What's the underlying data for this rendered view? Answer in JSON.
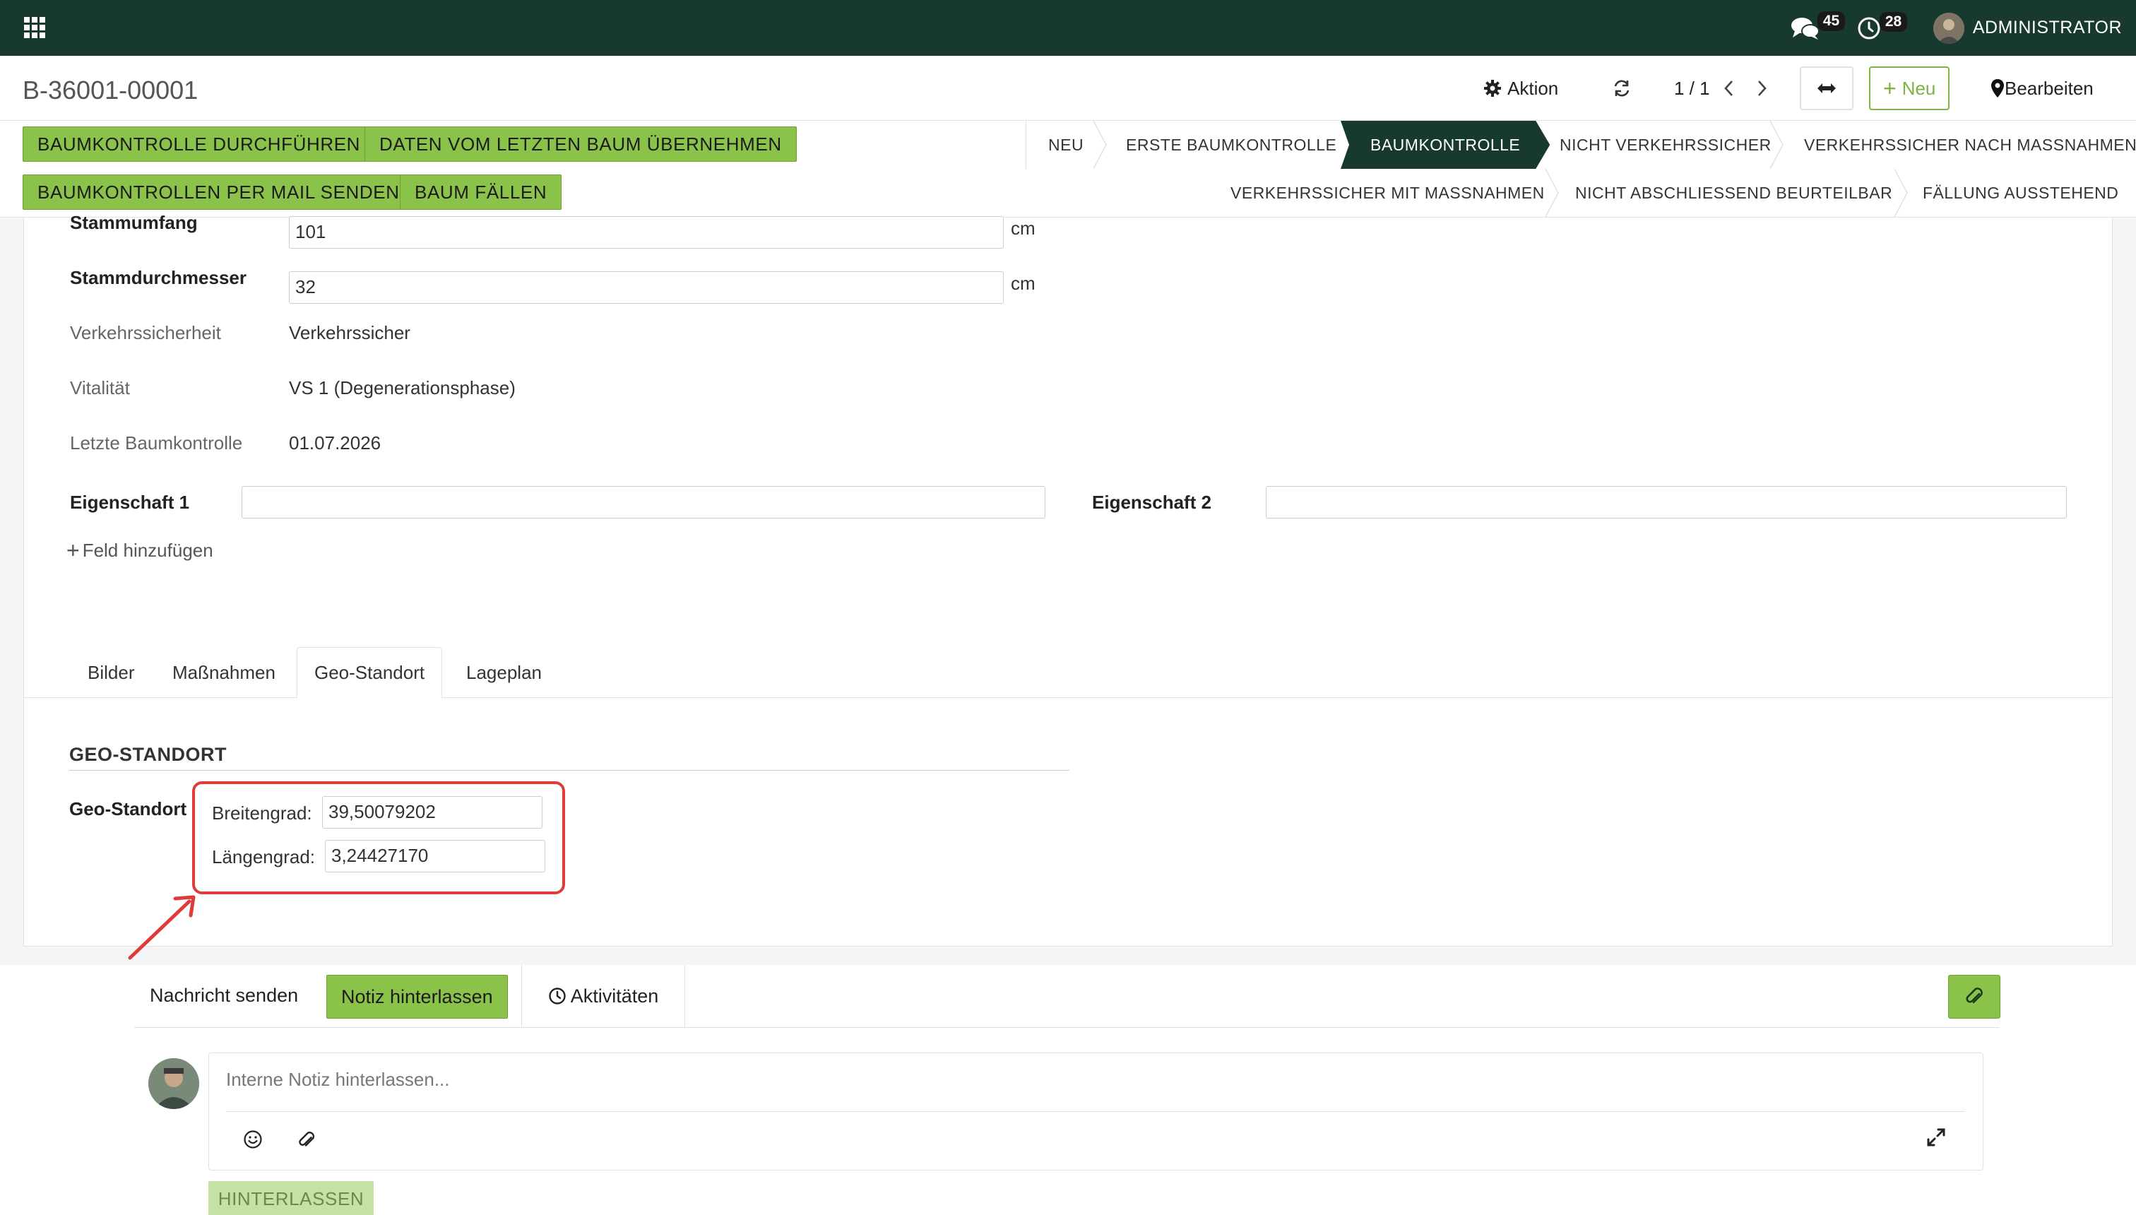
{
  "topbar": {
    "messages_count": "45",
    "activities_count": "28",
    "user_name": "ADMINISTRATOR"
  },
  "control": {
    "record_title": "B-36001-00001",
    "action_label": "Aktion",
    "pager": "1 / 1",
    "new_label": "Neu",
    "edit_label": "Bearbeiten"
  },
  "actions": {
    "btn1": "BAUMKONTROLLE DURCHFÜHREN",
    "btn2": "DATEN VOM LETZTEN BAUM ÜBERNEHMEN",
    "btn3": "BAUMKONTROLLEN PER MAIL SENDEN",
    "btn4": "BAUM FÄLLEN"
  },
  "stages": {
    "row1": [
      "NEU",
      "ERSTE BAUMKONTROLLE",
      "BAUMKONTROLLE",
      "NICHT VERKEHRSSICHER",
      "VERKEHRSSICHER NACH MASSNAHMEN"
    ],
    "row2": [
      "VERKEHRSSICHER MIT MASSNAHMEN",
      "NICHT ABSCHLIESSEND BEURTEILBAR",
      "FÄLLUNG AUSSTEHEND"
    ],
    "active": "BAUMKONTROLLE"
  },
  "form": {
    "stammumfang_label": "Stammumfang",
    "stammumfang_value": "101",
    "stammumfang_unit": "cm",
    "stammdurchmesser_label": "Stammdurchmesser",
    "stammdurchmesser_value": "32",
    "stammdurchmesser_unit": "cm",
    "verkehrssicherheit_label": "Verkehrssicherheit",
    "verkehrssicherheit_value": "Verkehrssicher",
    "vitalitaet_label": "Vitalität",
    "vitalitaet_value": "VS 1 (Degenerationsphase)",
    "letzte_label": "Letzte Baumkontrolle",
    "letzte_value": "01.07.2026",
    "eigenschaft1_label": "Eigenschaft 1",
    "eigenschaft1_value": "",
    "eigenschaft2_label": "Eigenschaft 2",
    "eigenschaft2_value": "",
    "add_field": "Feld hinzufügen"
  },
  "tabs": [
    "Bilder",
    "Maßnahmen",
    "Geo-Standort",
    "Lageplan"
  ],
  "geo": {
    "section_title": "GEO-STANDORT",
    "field_label": "Geo-Standort",
    "lat_label": "Breitengrad:",
    "lat_value": "39,50079202",
    "lon_label": "Längengrad:",
    "lon_value": "3,24427170"
  },
  "chatter": {
    "send_message": "Nachricht senden",
    "log_note": "Notiz hinterlassen",
    "activities": "Aktivitäten",
    "note_placeholder": "Interne Notiz hinterlassen...",
    "submit_label": "HINTERLASSEN"
  },
  "colors": {
    "topbar": "#183a2e",
    "accent_green": "#8bc34a",
    "highlight_red": "#e03b3b"
  }
}
